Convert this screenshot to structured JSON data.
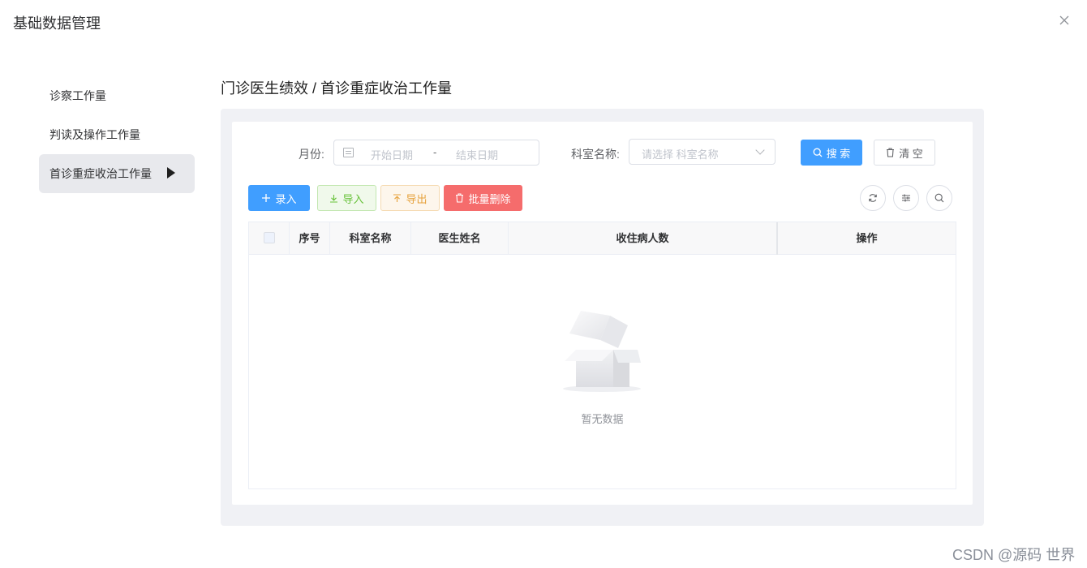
{
  "dialog": {
    "title": "基础数据管理",
    "close_icon": "close-icon"
  },
  "sidebar": {
    "items": [
      {
        "label": "诊察工作量",
        "active": false
      },
      {
        "label": "判读及操作工作量",
        "active": false
      },
      {
        "label": "首诊重症收治工作量",
        "active": true
      }
    ]
  },
  "breadcrumb": "门诊医生绩效 / 首诊重症收治工作量",
  "filters": {
    "month_label": "月份:",
    "start_placeholder": "开始日期",
    "range_separator": "-",
    "end_placeholder": "结束日期",
    "dept_label": "科室名称:",
    "dept_placeholder": "请选择 科室名称",
    "search_label": "搜 索",
    "clear_label": "清 空"
  },
  "toolbar": {
    "add_label": "录入",
    "import_label": "导入",
    "export_label": "导出",
    "batch_delete_label": "批量删除",
    "right_icons": [
      "refresh-icon",
      "columns-filter-icon",
      "search-toggle-icon"
    ]
  },
  "table": {
    "columns": [
      "序号",
      "科室名称",
      "医生姓名",
      "收住病人数",
      "操作"
    ],
    "rows": [],
    "empty_text": "暂无数据"
  },
  "colors": {
    "primary": "#409eff",
    "success": "#67c23a",
    "warning": "#e6a23c",
    "danger": "#f56c6c"
  },
  "watermark": "CSDN @源码 世界"
}
